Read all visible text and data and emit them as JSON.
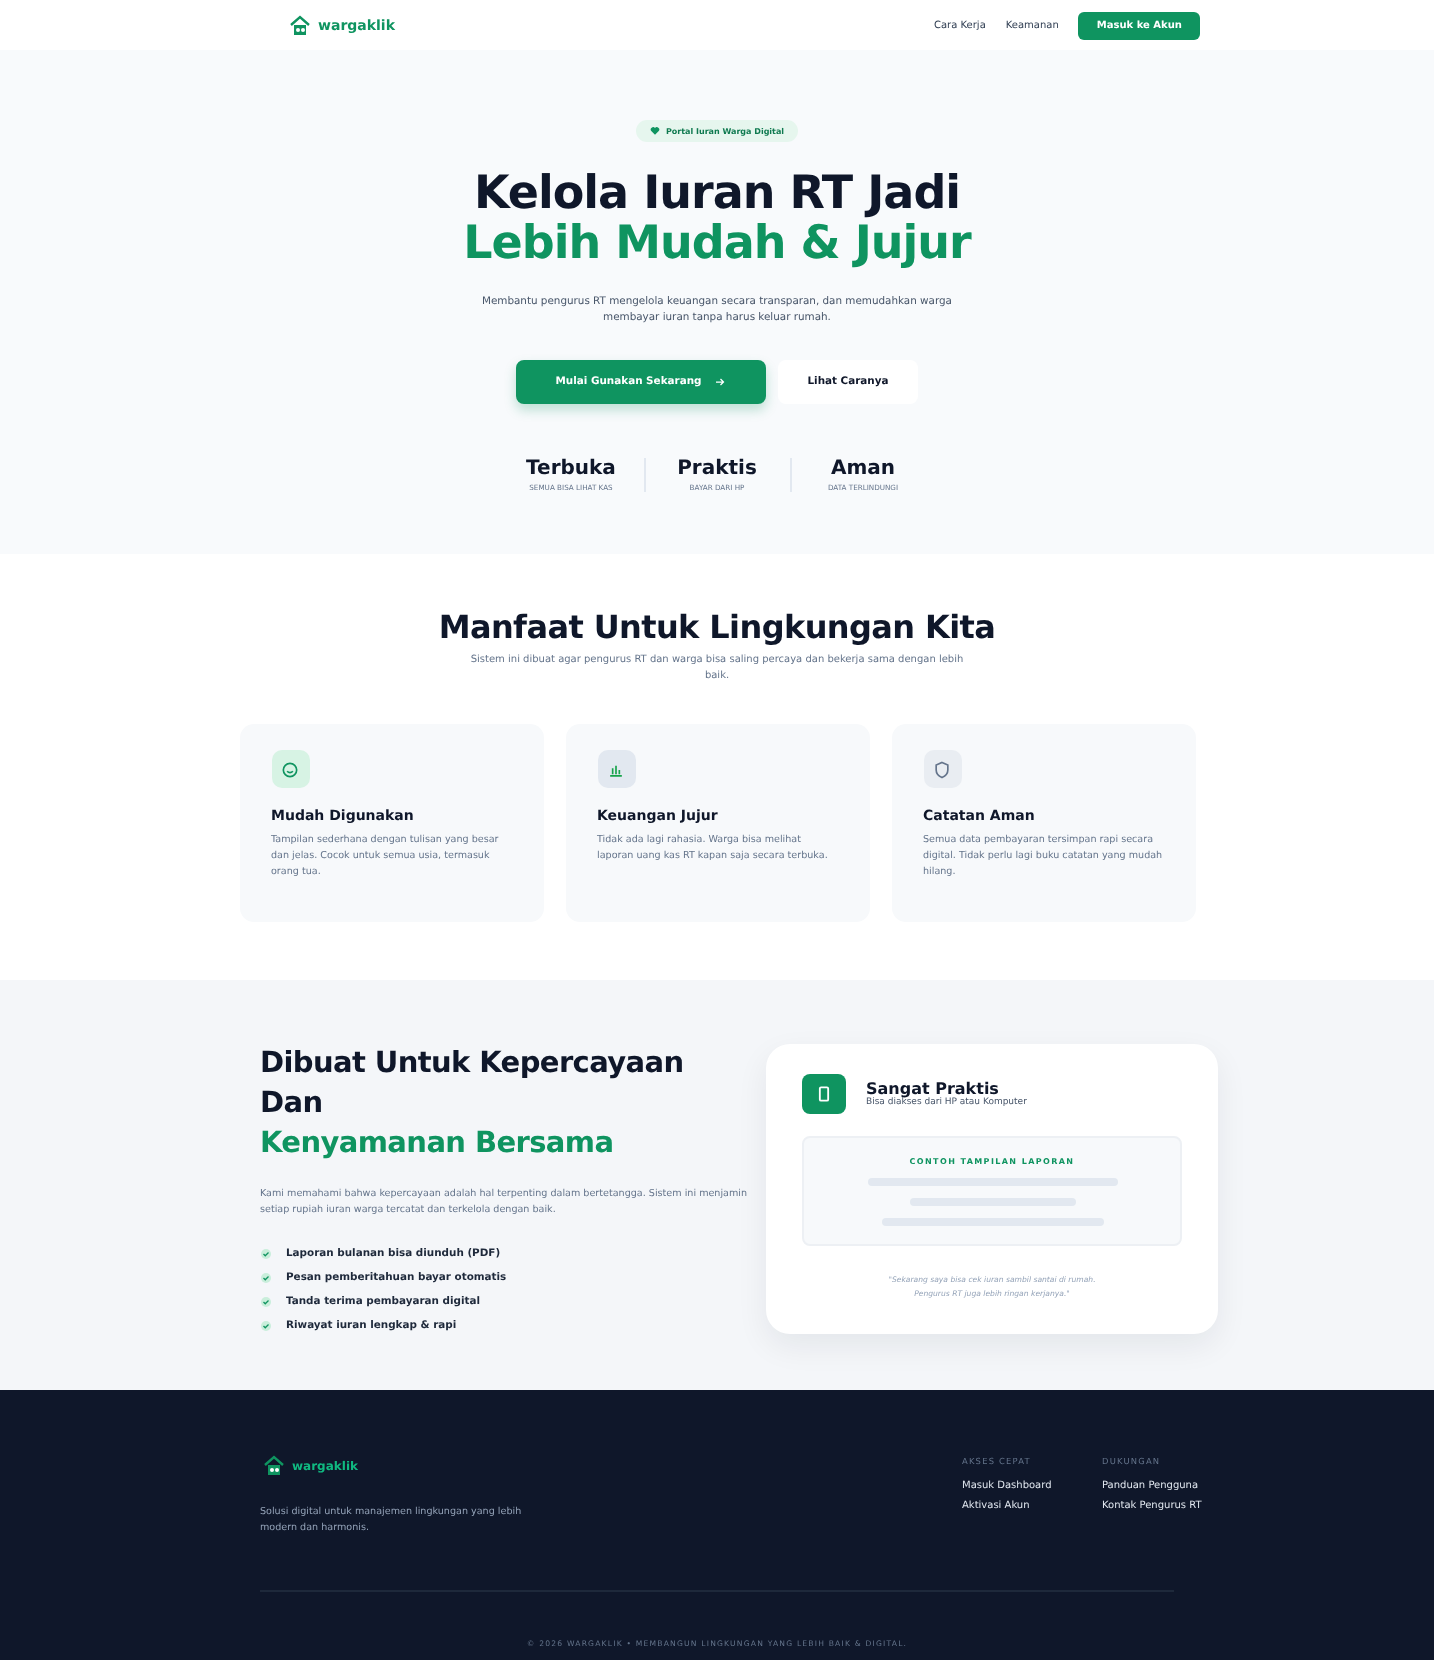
{
  "nav": {
    "logo": "wargaklik",
    "links": [
      "Cara Kerja",
      "Keamanan"
    ],
    "cta": "Masuk ke Akun"
  },
  "hero": {
    "badge": "Portal Iuran Warga Digital",
    "title_line1": "Kelola Iuran RT Jadi",
    "title_line2": "Lebih Mudah & Jujur",
    "subtitle": "Membantu pengurus RT mengelola keuangan secara transparan, dan memudahkan warga membayar iuran tanpa harus keluar rumah.",
    "primary_button": "Mulai Gunakan Sekarang",
    "secondary_button": "Lihat Caranya",
    "stats": [
      {
        "title": "Terbuka",
        "caption": "SEMUA BISA LIHAT KAS"
      },
      {
        "title": "Praktis",
        "caption": "BAYAR DARI HP"
      },
      {
        "title": "Aman",
        "caption": "DATA TERLINDUNGI"
      }
    ]
  },
  "benefits": {
    "title": "Manfaat Untuk Lingkungan Kita",
    "subtitle": "Sistem ini dibuat agar pengurus RT dan warga bisa saling percaya dan bekerja sama dengan lebih baik.",
    "cards": [
      {
        "kind": "smile",
        "title": "Mudah Digunakan",
        "text": "Tampilan sederhana dengan tulisan yang besar dan jelas. Cocok untuk semua usia, termasuk orang tua."
      },
      {
        "kind": "chart",
        "title": "Keuangan Jujur",
        "text": "Tidak ada lagi rahasia. Warga bisa melihat laporan uang kas RT kapan saja secara terbuka."
      },
      {
        "kind": "shield",
        "title": "Catatan Aman",
        "text": "Semua data pembayaran tersimpan rapi secara digital. Tidak perlu lagi buku catatan yang mudah hilang."
      }
    ]
  },
  "trust": {
    "title_line1": "Dibuat Untuk Kepercayaan",
    "title_line2_plain": "Dan",
    "title_line2_accent": "Kenyamanan Bersama",
    "text": "Kami memahami bahwa kepercayaan adalah hal terpenting dalam bertetangga. Sistem ini menjamin setiap rupiah iuran warga tercatat dan terkelola dengan baik.",
    "features": [
      "Laporan bulanan bisa diunduh (PDF)",
      "Pesan pemberitahuan bayar otomatis",
      "Tanda terima pembayaran digital",
      "Riwayat iuran lengkap & rapi"
    ],
    "card": {
      "title": "Sangat Praktis",
      "subtitle": "Bisa diakses dari HP atau Komputer",
      "preview_label": "CONTOH TAMPILAN LAPORAN",
      "quote": "\"Sekarang saya bisa cek iuran sambil santai di rumah. Pengurus RT juga lebih ringan kerjanya.\""
    }
  },
  "footer": {
    "logo": "wargaklik",
    "tagline": "Solusi digital untuk manajemen lingkungan yang lebih modern dan harmonis.",
    "columns": [
      {
        "heading": "AKSES CEPAT",
        "links": [
          "Masuk Dashboard",
          "Aktivasi Akun"
        ]
      },
      {
        "heading": "DUKUNGAN",
        "links": [
          "Panduan Pengguna",
          "Kontak Pengurus RT"
        ]
      }
    ],
    "copyright": "© 2026 WARGAKLIK • MEMBANGUN LINGKUNGAN YANG LEBIH BAIK & DIGITAL."
  }
}
